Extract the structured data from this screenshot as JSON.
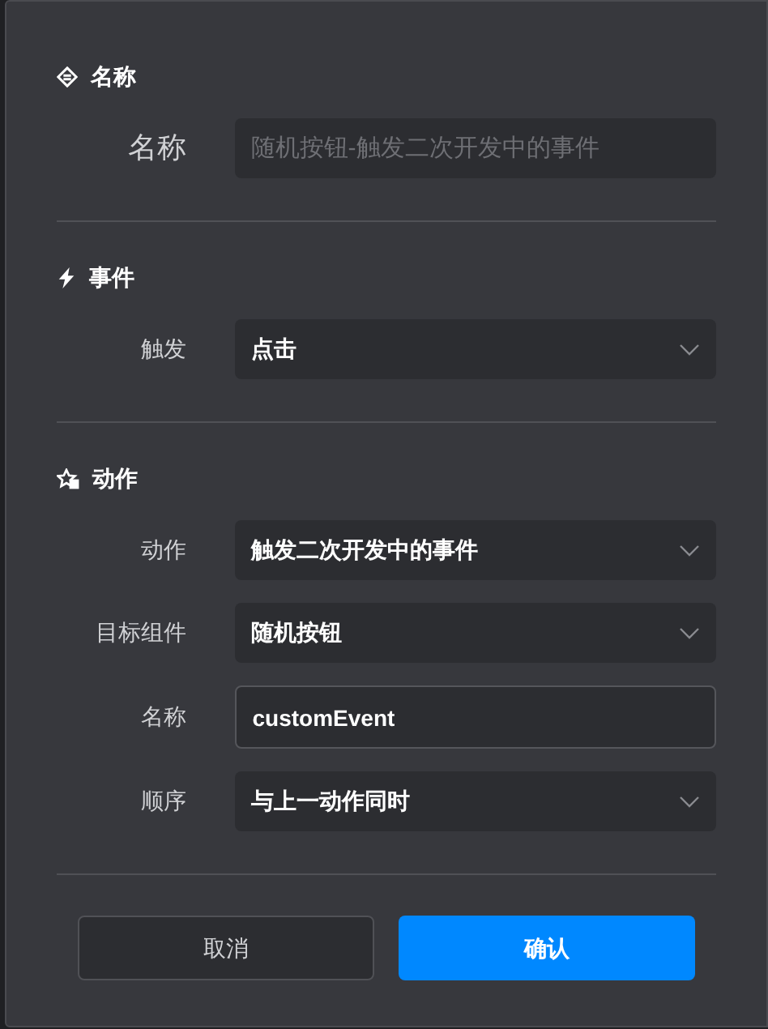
{
  "sections": [
    {
      "title": "名称",
      "fields": [
        {
          "label": "名称",
          "kind": "input",
          "placeholder": "随机按钮-触发二次开发中的事件"
        }
      ]
    },
    {
      "title": "事件",
      "fields": [
        {
          "label": "触发",
          "kind": "select",
          "value": "点击"
        }
      ]
    },
    {
      "title": "动作",
      "fields": [
        {
          "label": "动作",
          "kind": "select",
          "value": "触发二次开发中的事件"
        },
        {
          "label": "目标组件",
          "kind": "select",
          "value": "随机按钮"
        },
        {
          "label": "名称",
          "kind": "text",
          "value": "customEvent"
        },
        {
          "label": "顺序",
          "kind": "select",
          "value": "与上一动作同时"
        }
      ]
    }
  ],
  "buttons": [
    {
      "label": "取消",
      "kind": "secondary"
    },
    {
      "label": "确认",
      "kind": "primary"
    }
  ]
}
